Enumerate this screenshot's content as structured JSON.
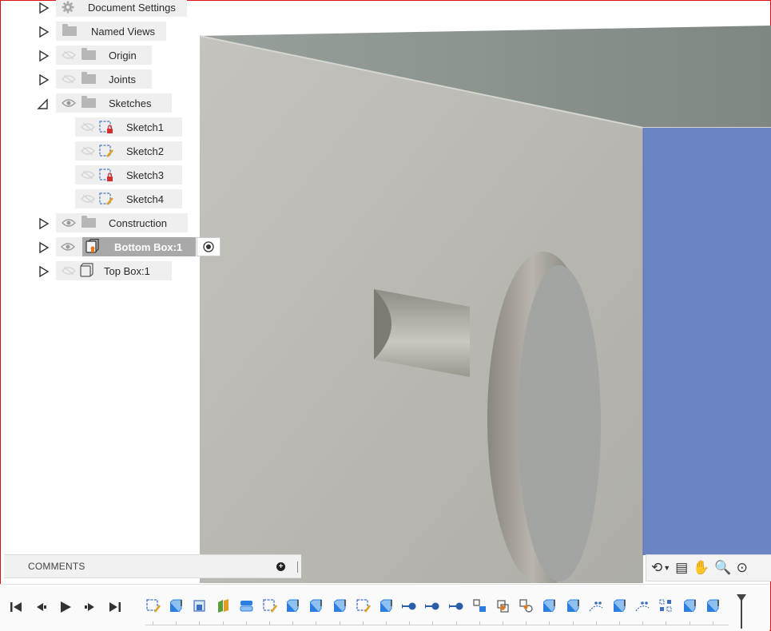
{
  "browser": {
    "items": [
      {
        "label": "Document Settings",
        "icon": "gear-icon"
      },
      {
        "label": "Named Views",
        "icon": "folder-icon"
      },
      {
        "label": "Origin",
        "icon": "folder-icon",
        "visibility": "hidden"
      },
      {
        "label": "Joints",
        "icon": "folder-icon",
        "visibility": "hidden"
      },
      {
        "label": "Sketches",
        "icon": "folder-icon",
        "visibility": "visible",
        "expanded": true
      },
      {
        "label": "Sketch1",
        "icon": "sketch-locked-icon",
        "visibility": "hidden"
      },
      {
        "label": "Sketch2",
        "icon": "sketch-edit-icon",
        "visibility": "hidden"
      },
      {
        "label": "Sketch3",
        "icon": "sketch-locked-icon",
        "visibility": "hidden"
      },
      {
        "label": "Sketch4",
        "icon": "sketch-edit-icon",
        "visibility": "hidden"
      },
      {
        "label": "Construction",
        "icon": "folder-icon",
        "visibility": "visible"
      },
      {
        "label": "Bottom Box:1",
        "icon": "component-icon",
        "visibility": "visible",
        "active": true
      },
      {
        "label": "Top Box:1",
        "icon": "component-icon",
        "visibility": "hidden"
      }
    ]
  },
  "comments": {
    "label": "COMMENTS"
  },
  "navbar": {
    "icons": [
      "orbit-icon",
      "look-at-icon",
      "pan-icon",
      "zoom-icon",
      "fit-icon"
    ]
  },
  "timeline": {
    "controls": [
      "go-to-start-icon",
      "step-back-icon",
      "play-icon",
      "step-forward-icon",
      "go-to-end-icon"
    ],
    "features": [
      "sketch",
      "extrude",
      "plane",
      "split",
      "fillet",
      "sketch",
      "extrude",
      "extrude",
      "extrude",
      "sketch",
      "extrude",
      "joint",
      "joint",
      "joint",
      "align",
      "rigid-group",
      "as-built-joint",
      "extrude",
      "extrude",
      "sketch-pattern",
      "extrude",
      "sketch-pattern",
      "pattern",
      "extrude",
      "extrude"
    ]
  },
  "colors": {
    "selected_face": "#6a84c4",
    "body_front": "#b8b7b2",
    "body_top": "#8b8f8b",
    "frame": "#dd1111"
  }
}
